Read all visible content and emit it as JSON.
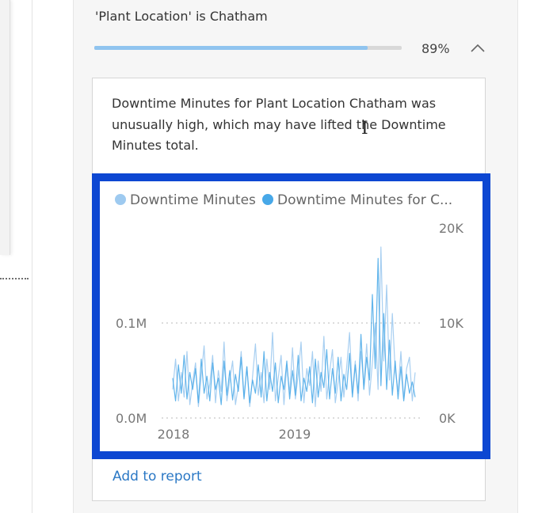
{
  "insight": {
    "heading": "'Plant Location' is Chatham",
    "progress_fraction": 0.89,
    "percent_label": "89%",
    "collapse_icon": "chevron-up-icon",
    "description": "Downtime Minutes for Plant Location Chatham was unusually high, which may have lifted the Downtime Minutes total.",
    "add_link": "Add to report"
  },
  "colors": {
    "frame_highlight": "#0d47d2",
    "series_1": "#9ecaf0",
    "series_2": "#47a8e8",
    "link": "#2b78c5"
  },
  "chart_data": {
    "type": "line",
    "legend": [
      "Downtime Minutes",
      "Downtime Minutes for C..."
    ],
    "legend_placement": "top-left",
    "x_tick_labels": [
      "2018",
      "2019"
    ],
    "y_left_ticks": [
      "0.0M",
      "0.1M"
    ],
    "y_right_ticks": [
      "0K",
      "10K",
      "20K"
    ],
    "y_left_range": [
      0,
      0.2
    ],
    "y_right_range": [
      0,
      20000
    ],
    "grid": "dotted horizontal",
    "series": [
      {
        "name": "Downtime Minutes",
        "axis": "left",
        "values": [
          0.03,
          0.062,
          0.018,
          0.048,
          0.022,
          0.07,
          0.014,
          0.038,
          0.058,
          0.012,
          0.044,
          0.076,
          0.02,
          0.036,
          0.066,
          0.016,
          0.05,
          0.028,
          0.08,
          0.018,
          0.04,
          0.06,
          0.014,
          0.034,
          0.07,
          0.022,
          0.054,
          0.012,
          0.044,
          0.078,
          0.024,
          0.048,
          0.016,
          0.062,
          0.03,
          0.09,
          0.018,
          0.042,
          0.066,
          0.014,
          0.056,
          0.026,
          0.074,
          0.02,
          0.046,
          0.08,
          0.016,
          0.052,
          0.034,
          0.07,
          0.012,
          0.06,
          0.028,
          0.086,
          0.02,
          0.048,
          0.072,
          0.016,
          0.038,
          0.064,
          0.022,
          0.054,
          0.09,
          0.026,
          0.06,
          0.018,
          0.07,
          0.034,
          0.078,
          0.024,
          0.058,
          0.1,
          0.03,
          0.18,
          0.06,
          0.14,
          0.04,
          0.11,
          0.05,
          0.028,
          0.07,
          0.02,
          0.052,
          0.064,
          0.018,
          0.048
        ]
      },
      {
        "name": "Downtime Minutes for C...",
        "axis": "right",
        "values": [
          4200,
          1800,
          5600,
          2600,
          6600,
          2000,
          4800,
          3000,
          5200,
          1600,
          6200,
          2600,
          4400,
          1800,
          5800,
          3000,
          4200,
          1400,
          6000,
          2400,
          5000,
          1900,
          4600,
          2800,
          6400,
          2000,
          5400,
          1600,
          4000,
          2600,
          5600,
          2200,
          7000,
          1800,
          4800,
          2800,
          5800,
          1600,
          4400,
          3000,
          6000,
          2000,
          5000,
          2400,
          6600,
          1800,
          4200,
          2800,
          5400,
          1600,
          6200,
          2200,
          4800,
          3200,
          7200,
          2000,
          5200,
          2600,
          6400,
          1800,
          4600,
          3000,
          6800,
          2200,
          5600,
          2600,
          8800,
          3000,
          6400,
          4000,
          13000,
          5200,
          16800,
          3400,
          11000,
          3000,
          8200,
          2400,
          6000,
          2000,
          5400,
          1800,
          4600,
          2600,
          3800,
          2200
        ]
      }
    ]
  }
}
